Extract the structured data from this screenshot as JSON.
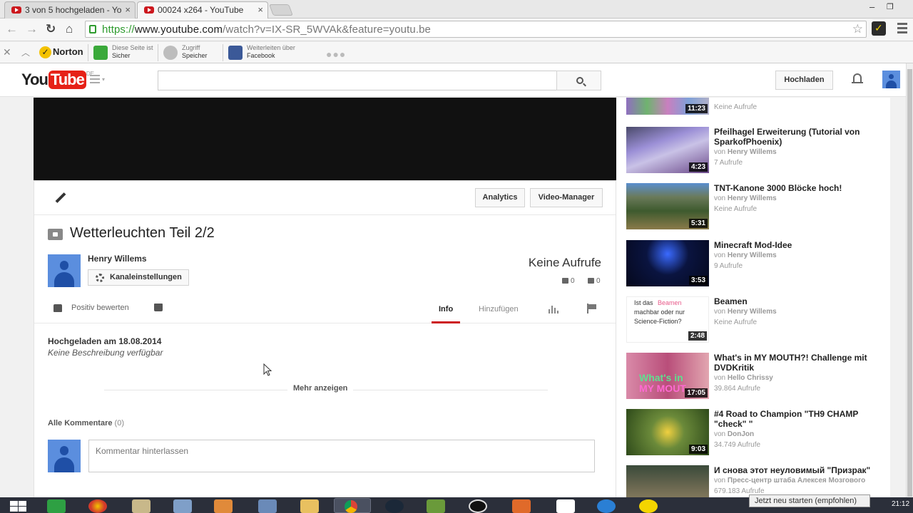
{
  "browser": {
    "tabs": [
      {
        "title": "3 von 5 hochgeladen - Yo",
        "active": false
      },
      {
        "title": "00024 x264 - YouTube",
        "active": true
      }
    ],
    "url": {
      "scheme": "https://",
      "host": "www.youtube.com",
      "path": "/watch?v=IX-SR_5WVAk&feature=youtu.be"
    }
  },
  "norton": {
    "brand": "Norton",
    "items": [
      {
        "line1": "Diese Seite ist",
        "line2": "Sicher",
        "icon": "green-check-icon"
      },
      {
        "line1": "Zugriff",
        "line2": "Speicher",
        "icon": "safe-icon"
      },
      {
        "line1": "Weiterleiten über",
        "line2": "Facebook",
        "icon": "facebook-icon"
      }
    ]
  },
  "masthead": {
    "logo_you": "You",
    "logo_tube": "Tube",
    "region": "DE",
    "upload_label": "Hochladen"
  },
  "video": {
    "title": "Wetterleuchten Teil 2/2",
    "owner": "Henry Willems",
    "channel_settings": "Kanaleinstellungen",
    "views": "Keine Aufrufe",
    "likes": "0",
    "dislikes": "0",
    "like_label": "Positiv bewerten",
    "creator_buttons": {
      "analytics": "Analytics",
      "video_manager": "Video-Manager"
    },
    "tabs": {
      "info": "Info",
      "add": "Hinzufügen"
    },
    "upload_date": "Hochgeladen am 18.08.2014",
    "description": "Keine Beschreibung verfügbar",
    "show_more": "Mehr anzeigen"
  },
  "comments": {
    "header": "Alle Kommentare",
    "count": "(0)",
    "placeholder": "Kommentar hinterlassen"
  },
  "related": [
    {
      "title": "",
      "channel": "",
      "views": "Keine Aufrufe",
      "duration": "11:23",
      "thumb": "#8aa0c8"
    },
    {
      "title": "Pfeilhagel Erweiterung (Tutorial von SparkofPhoenix)",
      "channel": "Henry Willems",
      "views": "7 Aufrufe",
      "duration": "4:23",
      "thumb": "#6f6a9a"
    },
    {
      "title": "TNT-Kanone 3000 Blöcke hoch!",
      "channel": "Henry Willems",
      "views": "Keine Aufrufe",
      "duration": "5:31",
      "thumb": "#6b7d5a"
    },
    {
      "title": "Minecraft Mod-Idee",
      "channel": "Henry Willems",
      "views": "9 Aufrufe",
      "duration": "3:53",
      "thumb": "#0b1440"
    },
    {
      "title": "Beamen",
      "channel": "Henry Willems",
      "views": "Keine Aufrufe",
      "duration": "2:48",
      "thumb": "#ffffff",
      "thumb_text": [
        "Ist das",
        "Beamen",
        "machbar oder nur",
        "Science-Fiction?"
      ]
    },
    {
      "title": "What's in MY MOUTH?! Challenge mit DVDKritik",
      "channel": "Hello Chrissy",
      "views": "39.864 Aufrufe",
      "duration": "17:05",
      "thumb": "#c66a8e",
      "thumb_text": [
        "What's in",
        "MY MOUT"
      ]
    },
    {
      "title": "#4 Road to Champion \"TH9 CHAMP \"check\" \"",
      "channel": "DonJon",
      "views": "34.749 Aufrufe",
      "duration": "9:03",
      "thumb": "#4a6b2c"
    },
    {
      "title": "И снова этот неуловимый \"Призрак\"",
      "channel": "Пресс-центр штаба Алексея Мозгового",
      "views": "679.183 Aufrufe",
      "duration": "",
      "thumb": "#5e5a48"
    }
  ],
  "by_prefix": "von",
  "taskbar": {
    "notification": "Jetzt neu starten (empfohlen)",
    "clock": "21:12"
  }
}
